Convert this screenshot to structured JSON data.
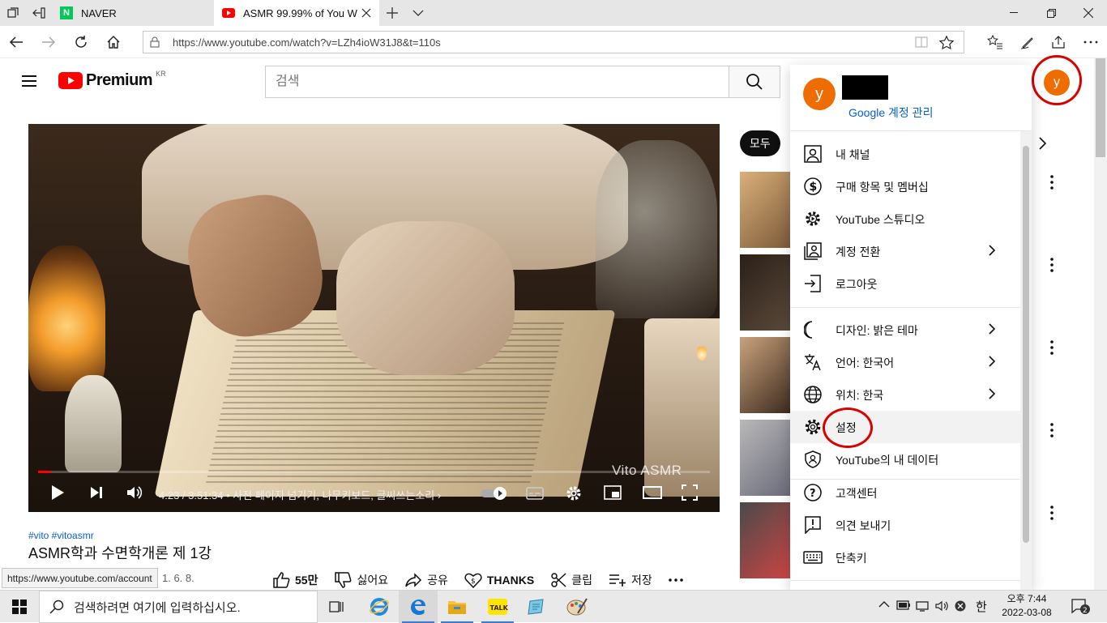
{
  "browser": {
    "tabs": [
      {
        "label": "NAVER",
        "active": false
      },
      {
        "label": "ASMR 99.99% of You W",
        "active": true
      }
    ],
    "address": "https://www.youtube.com/watch?v=LZh4ioW31J8&t=110s",
    "status_url": "https://www.youtube.com/account"
  },
  "youtube": {
    "logo_text": "Premium",
    "logo_region": "KR",
    "search_placeholder": "검색",
    "avatar_letter": "y"
  },
  "player": {
    "time": "4:23 / 3:51:34",
    "chapter": "• 사전 페이지 넘기기, 나무키보드, 글씨쓰는소리",
    "watermark": "Vito ASMR",
    "progress_fraction": 0.019
  },
  "video": {
    "tags": "#vito #vitoasmr",
    "title": "ASMR학과 수면학개론 제 1강",
    "date_fragment": "1. 6. 8.",
    "actions": [
      {
        "icon": "like-icon",
        "label": "55만",
        "bold": true
      },
      {
        "icon": "dislike-icon",
        "label": "싫어요",
        "bold": false
      },
      {
        "icon": "share-icon",
        "label": "공유",
        "bold": false
      },
      {
        "icon": "thanks-icon",
        "label": "THANKS",
        "bold": true
      },
      {
        "icon": "clip-icon",
        "label": "클립",
        "bold": false
      },
      {
        "icon": "save-icon",
        "label": "저장",
        "bold": false
      }
    ]
  },
  "related": {
    "chip_all": "모두"
  },
  "account_menu": {
    "avatar_letter": "y",
    "manage_label": "Google 계정 관리",
    "items": [
      {
        "name": "my-channel",
        "icon": "person-icon",
        "label": "내 채널",
        "chevron": false
      },
      {
        "name": "purchases",
        "icon": "dollar-icon",
        "label": "구매 항목 및 멤버십",
        "chevron": false
      },
      {
        "name": "studio",
        "icon": "studio-gear-icon",
        "label": "YouTube 스튜디오",
        "chevron": false
      },
      {
        "name": "switch-account",
        "icon": "switch-account-icon",
        "label": "계정 전환",
        "chevron": true
      },
      {
        "name": "logout",
        "icon": "logout-icon",
        "label": "로그아웃",
        "chevron": false
      },
      {
        "name": "theme",
        "icon": "moon-icon",
        "label": "디자인: 밝은 테마",
        "chevron": true
      },
      {
        "name": "language",
        "icon": "translate-icon",
        "label": "언어: 한국어",
        "chevron": true
      },
      {
        "name": "location",
        "icon": "globe-icon",
        "label": "위치: 한국",
        "chevron": true
      },
      {
        "name": "settings",
        "icon": "gear-icon",
        "label": "설정",
        "chevron": false
      },
      {
        "name": "your-data",
        "icon": "shield-person-icon",
        "label": "YouTube의 내 데이터",
        "chevron": false
      },
      {
        "name": "help",
        "icon": "help-icon",
        "label": "고객센터",
        "chevron": false
      },
      {
        "name": "feedback",
        "icon": "feedback-icon",
        "label": "의견 보내기",
        "chevron": false
      },
      {
        "name": "shortcuts",
        "icon": "keyboard-icon",
        "label": "단축키",
        "chevron": false
      }
    ]
  },
  "taskbar": {
    "search_placeholder": "검색하려면 여기에 입력하십시오.",
    "time": "오후 7:44",
    "date": "2022-03-08",
    "notification_count": "2",
    "ime": "한"
  },
  "colors": {
    "youtube_red": "#ff0000",
    "avatar": "#ef6c00",
    "link": "#065fd4",
    "annotation_circle": "#d90000"
  }
}
